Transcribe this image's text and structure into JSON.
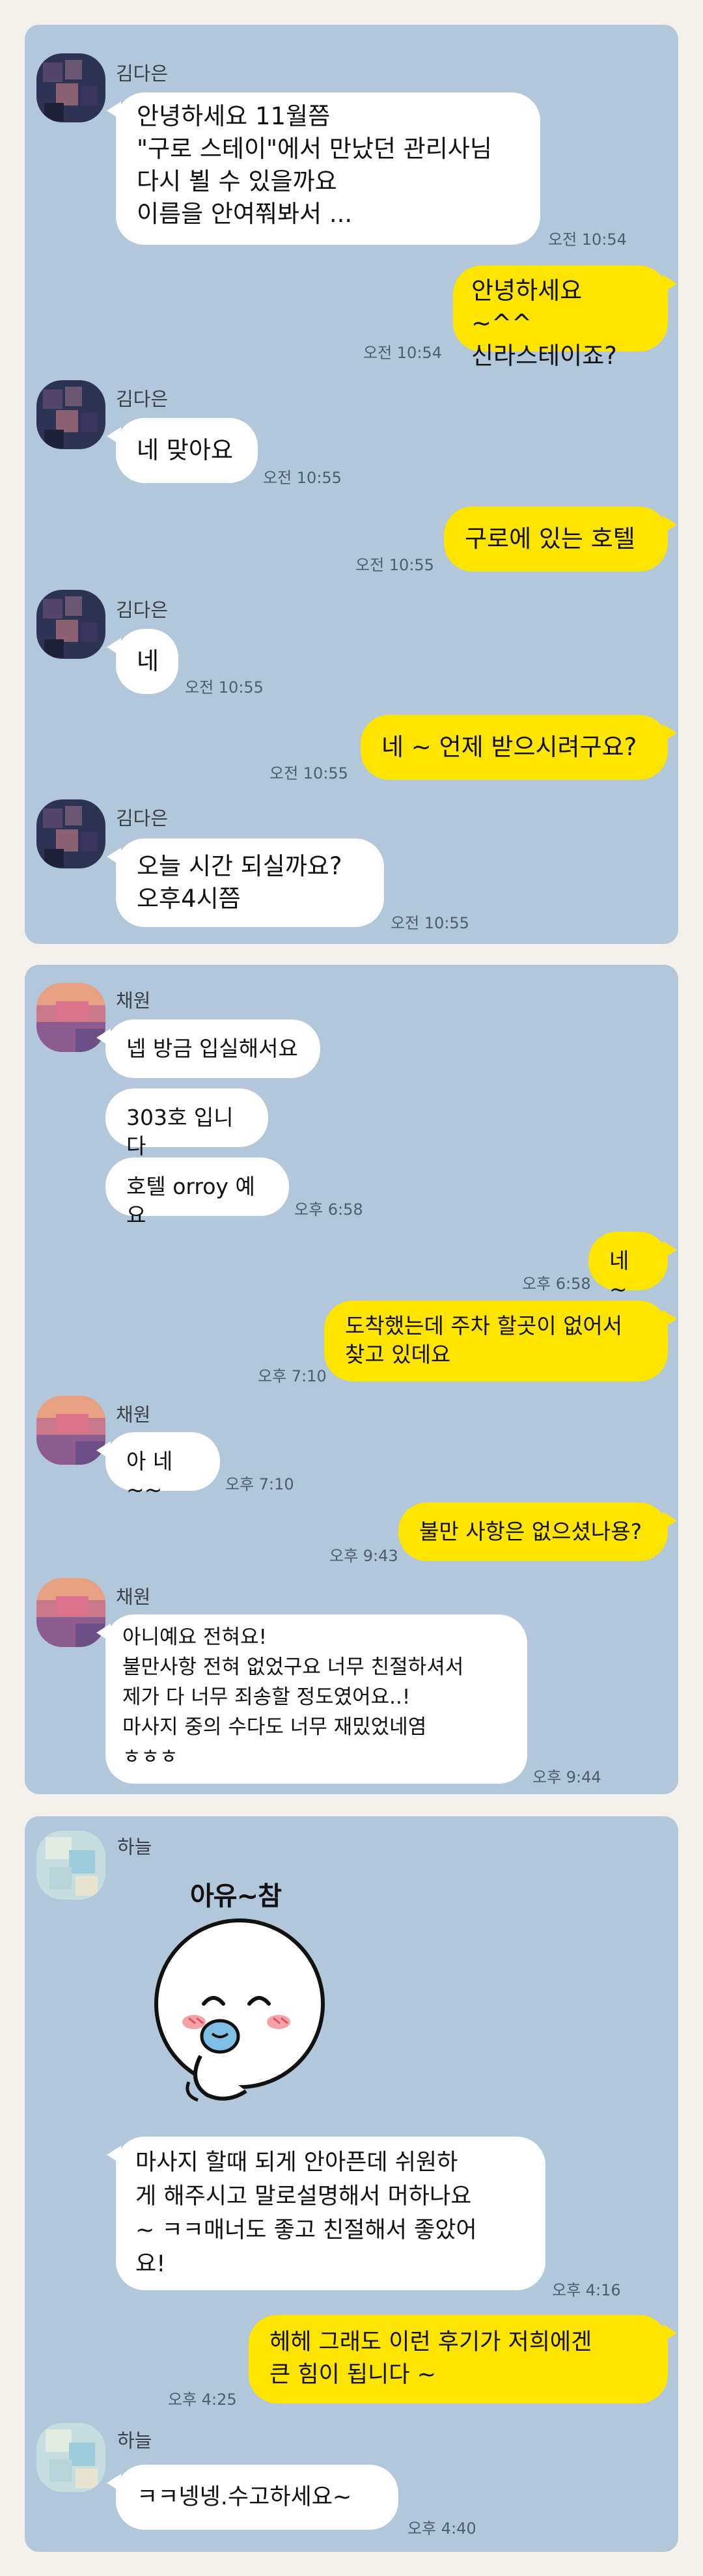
{
  "colors": {
    "background": "#f4f0ec",
    "chat_background": "#b2c7da",
    "incoming_bubble": "#ffffff",
    "outgoing_bubble": "#fee500",
    "timestamp": "#4f5d6a"
  },
  "chat1": {
    "sender_name": "김다은",
    "messages": [
      {
        "text": "안녕하세요 11월쯤\n\"구로 스테이\"에서 만났던 관리사님\n다시 뵐 수 있을까요\n이름을 안여쭤봐서 ...",
        "time": "오전 10:54"
      },
      {
        "text": "안녕하세요 ~^^\n신라스테이죠?",
        "time": "오전 10:54"
      },
      {
        "text": "네 맞아요",
        "time": "오전 10:55"
      },
      {
        "text": "구로에 있는 호텔",
        "time": "오전 10:55"
      },
      {
        "text": "네",
        "time": "오전 10:55"
      },
      {
        "text": "네 ~ 언제 받으시려구요?",
        "time": "오전 10:55"
      },
      {
        "text": "오늘  시간 되실까요?\n오후4시쯤",
        "time": "오전 10:55"
      }
    ]
  },
  "chat2": {
    "sender_name": "채원",
    "messages": [
      {
        "text": "넵 방금 입실해서요"
      },
      {
        "text": "303호 입니다"
      },
      {
        "text": "호텔 orroy 예요",
        "time": "오후 6:58"
      },
      {
        "text": "네 ~",
        "time": "오후 6:58"
      },
      {
        "text": "도착했는데  주차 할곳이 없어서\n찾고 있데요",
        "time": "오후 7:10"
      },
      {
        "text": "아 네~~",
        "time": "오후 7:10"
      },
      {
        "text": "불만 사항은 없으셨나용?",
        "time": "오후 9:43"
      },
      {
        "text": "아니예요 전혀요!\n불만사항 전혀 없었구요 너무 친절하셔서\n제가 다 너무 죄송할 정도였어요..!\n마사지 중의 수다도 너무 재밌었네염\nㅎㅎㅎ",
        "time": "오후 9:44"
      }
    ]
  },
  "chat3": {
    "sender_name": "하늘",
    "sticker_text": "아유~참",
    "sticker_icon": "blushing-face-sticker",
    "messages": [
      {
        "text": "마사지 할때 되게 안아픈데 쉬원하\n게 해주시고 말로설명해서 머하나요\n~ ㅋㅋ매너도 좋고 친절해서 좋았어\n요!",
        "time": "오후 4:16"
      },
      {
        "text": "헤헤 그래도 이런 후기가 저희에겐\n큰 힘이 됩니다 ~",
        "time": "오후 4:25"
      },
      {
        "text": "ㅋㅋ넹넹.수고하세요~",
        "time": "오후 4:40"
      }
    ]
  }
}
